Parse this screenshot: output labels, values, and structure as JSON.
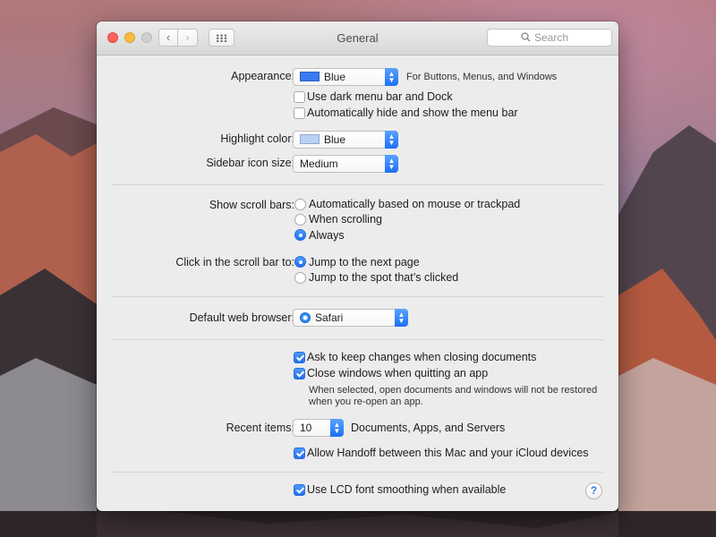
{
  "window": {
    "title": "General"
  },
  "search": {
    "placeholder": "Search"
  },
  "appearance": {
    "label": "Appearance:",
    "value": "Blue",
    "swatch_color": "#3a7af2",
    "note": "For Buttons, Menus, and Windows",
    "dark_menu_bar": {
      "label": "Use dark menu bar and Dock",
      "checked": false
    },
    "auto_hide_menu_bar": {
      "label": "Automatically hide and show the menu bar",
      "checked": false
    }
  },
  "highlight_color": {
    "label": "Highlight color:",
    "value": "Blue",
    "swatch_color": "#b9d3f7"
  },
  "sidebar_icon_size": {
    "label": "Sidebar icon size:",
    "value": "Medium"
  },
  "scroll_bars": {
    "label": "Show scroll bars:",
    "options": [
      {
        "label": "Automatically based on mouse or trackpad",
        "selected": false
      },
      {
        "label": "When scrolling",
        "selected": false
      },
      {
        "label": "Always",
        "selected": true
      }
    ]
  },
  "click_scroll_bar": {
    "label": "Click in the scroll bar to:",
    "options": [
      {
        "label": "Jump to the next page",
        "selected": true
      },
      {
        "label": "Jump to the spot that’s clicked",
        "selected": false
      }
    ]
  },
  "default_browser": {
    "label": "Default web browser:",
    "value": "Safari",
    "icon": "safari-icon"
  },
  "documents": {
    "ask_keep_changes": {
      "label": "Ask to keep changes when closing documents",
      "checked": true
    },
    "close_windows": {
      "label": "Close windows when quitting an app",
      "checked": true
    },
    "note_line1": "When selected, open documents and windows will not be restored",
    "note_line2": "when you re-open an app."
  },
  "recent_items": {
    "label": "Recent items:",
    "value": "10",
    "suffix": "Documents, Apps, and Servers"
  },
  "handoff": {
    "label": "Allow Handoff between this Mac and your iCloud devices",
    "checked": true
  },
  "lcd_smoothing": {
    "label": "Use LCD font smoothing when available",
    "checked": true
  },
  "help": {
    "glyph": "?"
  },
  "nav": {
    "back_glyph": "‹",
    "forward_glyph": "›"
  }
}
